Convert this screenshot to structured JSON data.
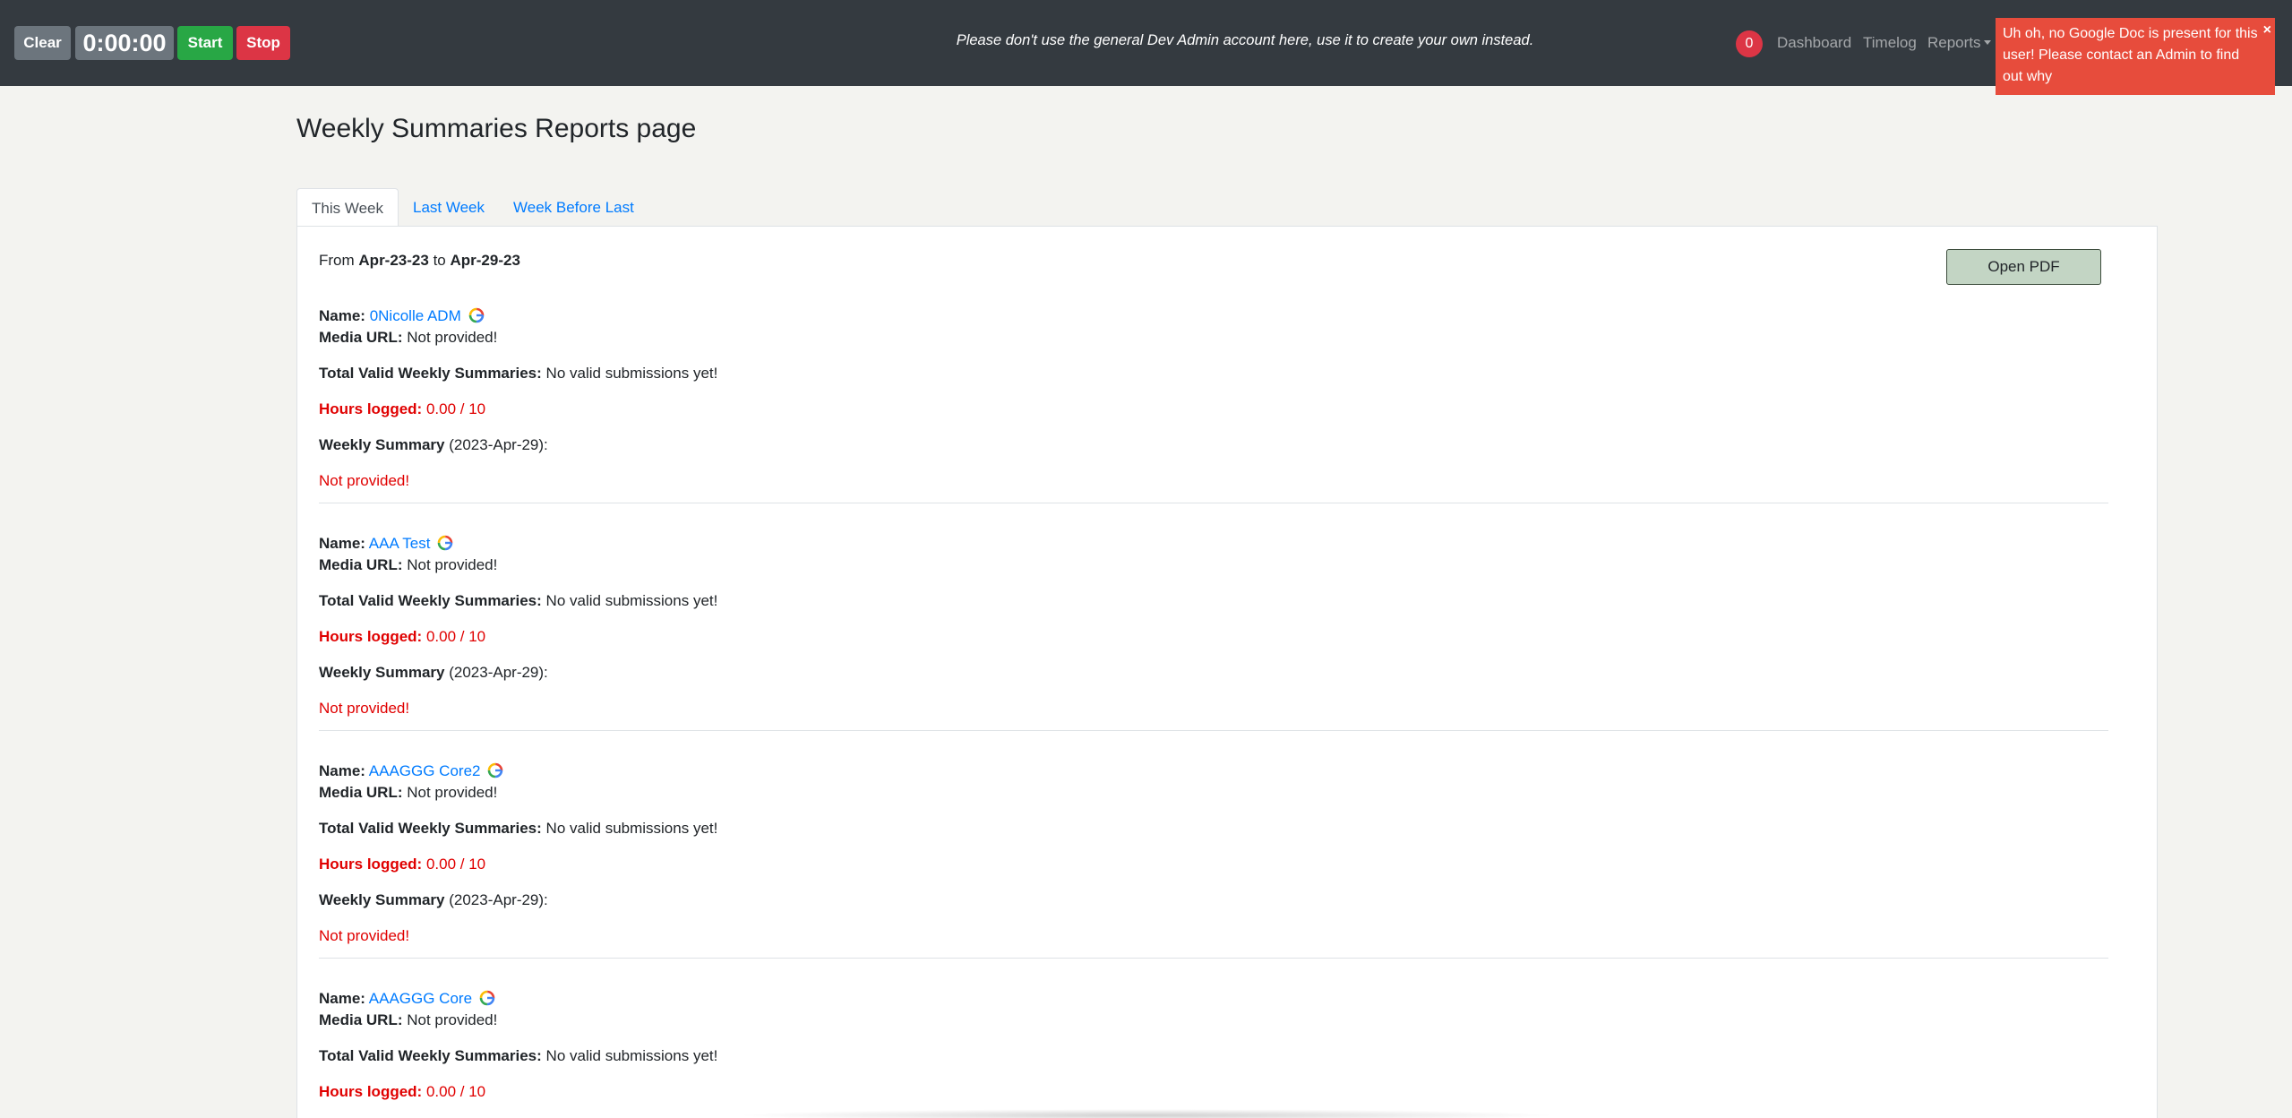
{
  "navbar": {
    "clear_label": "Clear",
    "timer": "0:00:00",
    "start_label": "Start",
    "stop_label": "Stop",
    "banner": "Please don't use the general Dev Admin account here, use it to create your own instead.",
    "notification_count": "0",
    "links": {
      "dashboard": "Dashboard",
      "timelog": "Timelog",
      "reports": "Reports"
    }
  },
  "toast": {
    "message": "Uh oh, no Google Doc is present for this user! Please contact an Admin to find out why",
    "close": "×"
  },
  "page": {
    "title": "Weekly Summaries Reports page",
    "tabs": [
      "This Week",
      "Last Week",
      "Week Before Last"
    ],
    "active_tab": "This Week",
    "range_from_label": "From",
    "range_from": "Apr-23-23",
    "range_to_label": "to",
    "range_to": "Apr-29-23",
    "open_pdf": "Open PDF"
  },
  "labels": {
    "name": "Name:",
    "media_url": "Media URL:",
    "total_valid": "Total Valid Weekly Summaries:",
    "hours_logged": "Hours logged:",
    "weekly_summary": "Weekly Summary"
  },
  "entries": [
    {
      "name": "0Nicolle ADM",
      "media_url": "Not provided!",
      "total_valid": "No valid submissions yet!",
      "hours": "0.00 / 10",
      "summary_date": "(2023-Apr-29):",
      "summary": "Not provided!"
    },
    {
      "name": "AAA Test",
      "media_url": "Not provided!",
      "total_valid": "No valid submissions yet!",
      "hours": "0.00 / 10",
      "summary_date": "(2023-Apr-29):",
      "summary": "Not provided!"
    },
    {
      "name": "AAAGGG Core2",
      "media_url": "Not provided!",
      "total_valid": "No valid submissions yet!",
      "hours": "0.00 / 10",
      "summary_date": "(2023-Apr-29):",
      "summary": "Not provided!"
    },
    {
      "name": "AAAGGG Core",
      "media_url": "Not provided!",
      "total_valid": "No valid submissions yet!",
      "hours": "0.00 / 10"
    }
  ],
  "colors": {
    "navbar": "#343a40",
    "start": "#28a745",
    "stop": "#dc3545",
    "toast": "#e74c3c",
    "link": "#007bff",
    "alert_text": "#e00000"
  }
}
